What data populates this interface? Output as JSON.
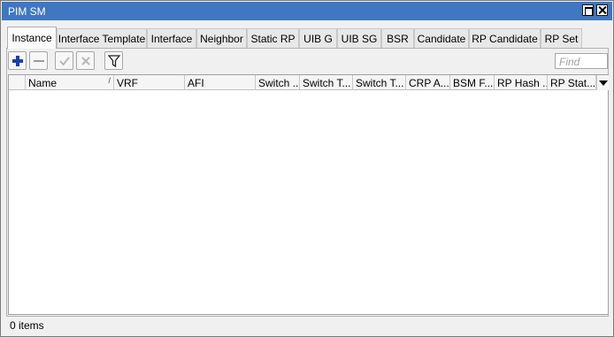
{
  "window": {
    "title": "PIM SM"
  },
  "tabs": [
    {
      "label": "Instance"
    },
    {
      "label": "Interface Template"
    },
    {
      "label": "Interface"
    },
    {
      "label": "Neighbor"
    },
    {
      "label": "Static RP"
    },
    {
      "label": "UIB G"
    },
    {
      "label": "UIB SG"
    },
    {
      "label": "BSR"
    },
    {
      "label": "Candidate"
    },
    {
      "label": "RP Candidate"
    },
    {
      "label": "RP Set"
    }
  ],
  "toolbar": {
    "add_icon": "plus-icon",
    "remove_icon": "minus-icon",
    "enable_icon": "check-icon",
    "disable_icon": "x-icon",
    "filter_icon": "filter-icon"
  },
  "search": {
    "placeholder": "Find"
  },
  "table": {
    "columns": [
      {
        "label": "Name"
      },
      {
        "label": "VRF"
      },
      {
        "label": "AFI"
      },
      {
        "label": "Switch ..."
      },
      {
        "label": "Switch T..."
      },
      {
        "label": "Switch T..."
      },
      {
        "label": "CRP A..."
      },
      {
        "label": "BSM F..."
      },
      {
        "label": "RP Hash ..."
      },
      {
        "label": "RP Stat..."
      }
    ],
    "sort_indicator": "/",
    "rows": []
  },
  "status": {
    "text": "0 items"
  },
  "colors": {
    "titlebar": "#3f77c0",
    "add_icon": "#1a3fa8"
  }
}
